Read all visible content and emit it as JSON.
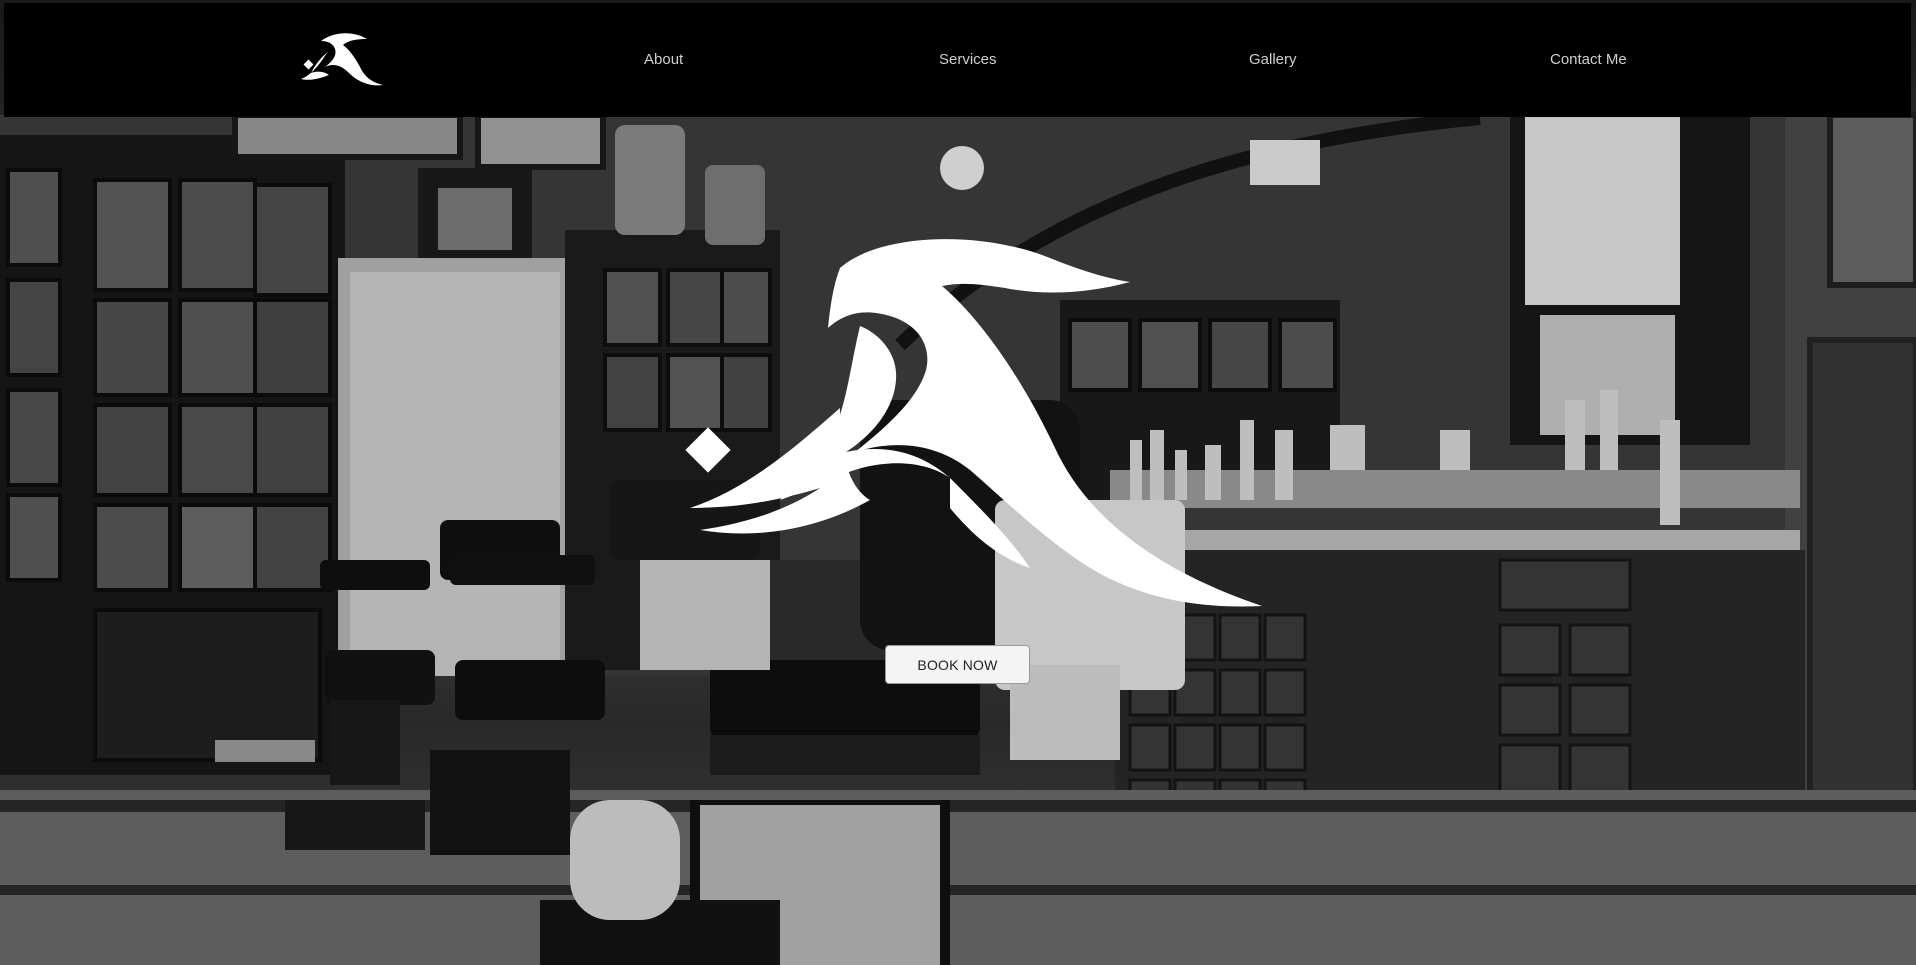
{
  "nav": {
    "logo_icon": "blackletter-monogram-logo",
    "links": [
      {
        "label": "About"
      },
      {
        "label": "Services"
      },
      {
        "label": "Gallery"
      },
      {
        "label": "Contact Me"
      }
    ]
  },
  "hero": {
    "image": "black-and-white barbershop interior with vintage barber chairs, cabinets and mirror",
    "logo_icon": "blackletter-monogram-logo",
    "book_button_label": "BOOK NOW"
  },
  "colors": {
    "navbar": "#000000",
    "nav_text": "#cfcfcf",
    "button_bg": "#f4f4f4",
    "button_text": "#222222"
  }
}
